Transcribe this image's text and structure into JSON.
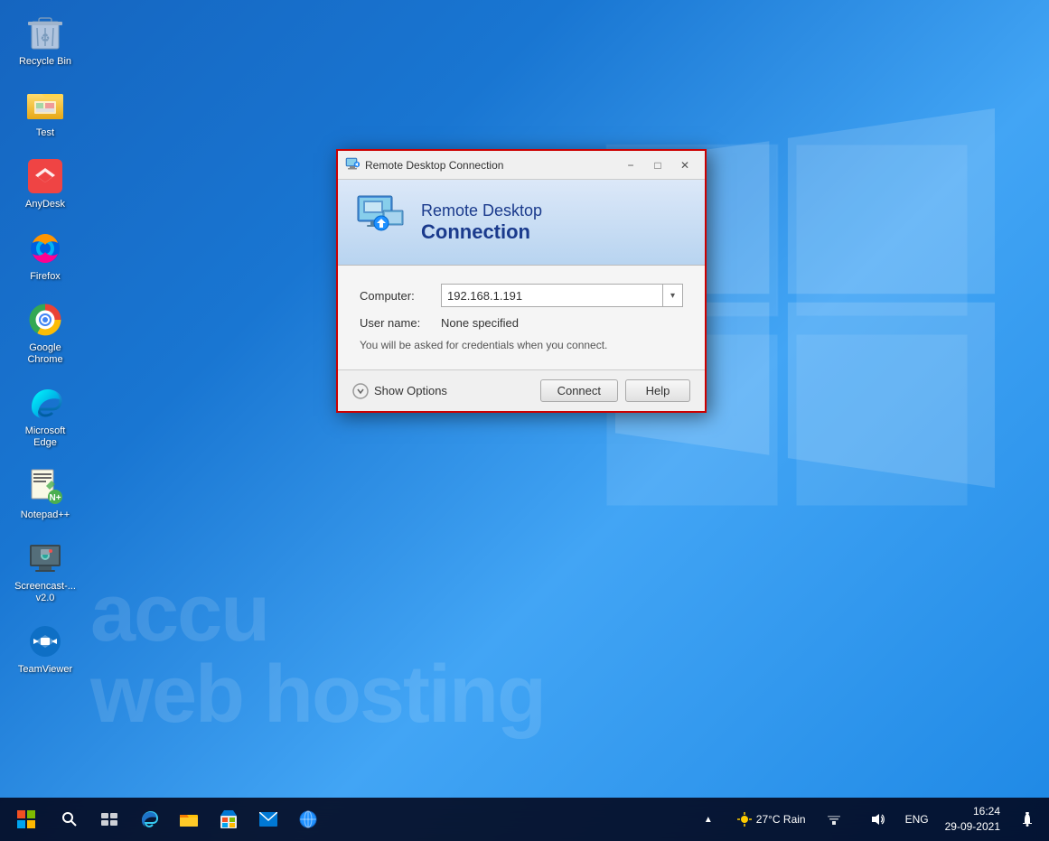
{
  "desktop": {
    "background": "blue-gradient",
    "watermark": {
      "line1": "accu",
      "line2": "web hosting"
    }
  },
  "icons": [
    {
      "id": "recycle-bin",
      "label": "Recycle Bin",
      "icon_type": "recycle"
    },
    {
      "id": "test-folder",
      "label": "Test",
      "icon_type": "folder"
    },
    {
      "id": "anydesk",
      "label": "AnyDesk",
      "icon_type": "anydesk"
    },
    {
      "id": "firefox",
      "label": "Firefox",
      "icon_type": "firefox"
    },
    {
      "id": "google-chrome",
      "label": "Google Chrome",
      "icon_type": "chrome"
    },
    {
      "id": "microsoft-edge",
      "label": "Microsoft Edge",
      "icon_type": "edge"
    },
    {
      "id": "notepadpp",
      "label": "Notepad++",
      "icon_type": "notepadpp"
    },
    {
      "id": "screencast",
      "label": "Screencast-... v2.0",
      "icon_type": "screencast"
    },
    {
      "id": "teamviewer",
      "label": "TeamViewer",
      "icon_type": "teamviewer"
    }
  ],
  "rdp_dialog": {
    "title": "Remote Desktop Connection",
    "header_line1": "Remote Desktop",
    "header_line2": "Connection",
    "computer_label": "Computer:",
    "computer_value": "192.168.1.191",
    "username_label": "User name:",
    "username_value": "None specified",
    "credentials_text": "You will be asked for credentials when you connect.",
    "show_options_label": "Show Options",
    "connect_btn": "Connect",
    "help_btn": "Help"
  },
  "taskbar": {
    "items": [
      "start",
      "search",
      "taskview",
      "edge",
      "file-explorer",
      "store",
      "mail",
      "globe"
    ],
    "systray": {
      "weather": "27°C Rain",
      "language": "ENG",
      "time": "16:24",
      "date": "29-09-2021"
    }
  }
}
